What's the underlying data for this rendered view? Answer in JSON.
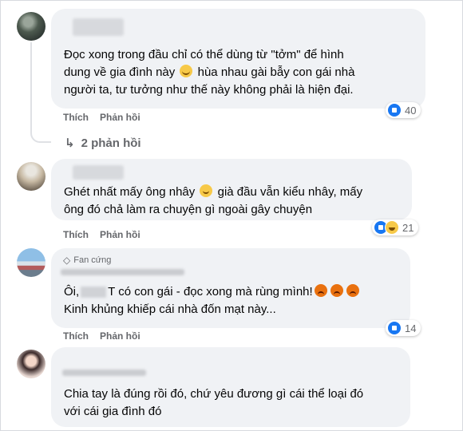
{
  "comments": [
    {
      "text_lines": [
        "Đọc xong trong đầu chỉ có thể dùng từ \"tởm\" để hình",
        "dung về gia đình này",
        "hùa nhau gài bẫy con gái nhà",
        "người ta, tư tưởng như thế này không phải là hiện đại."
      ],
      "reaction_count": "40",
      "replies_label": "2 phản hồi"
    },
    {
      "text_lines": [
        "Ghét nhất mấy ông nhây",
        "già đầu vẫn kiểu nhây, mấy",
        "ông đó chả làm ra chuyện gì ngoài gây chuyện"
      ],
      "reaction_count": "21"
    },
    {
      "badge": "Fan cứng",
      "text_lines": [
        "Ôi,",
        "T có con gái - đọc xong mà rùng mình!",
        "Kinh khủng khiếp cái nhà đốn mạt này..."
      ],
      "reaction_count": "14"
    },
    {
      "text_lines": [
        "Chia tay là đúng rồi đó, chứ yêu đương gì cái thể loại đó",
        "với cái gia đình đó"
      ]
    }
  ],
  "actions": {
    "like_label": "Thích",
    "reply_label": "Phản hồi"
  },
  "colors": {
    "bubble": "#f0f2f5",
    "action_text": "#65676b",
    "like_blue": "#1877f2",
    "haha_yellow": "#f7c948",
    "angry_orange": "#e9710f"
  },
  "icons": {
    "like": "like-reaction-icon",
    "haha": "haha-reaction-icon",
    "badge": "diamond-icon",
    "reply": "reply-arrow-icon"
  }
}
